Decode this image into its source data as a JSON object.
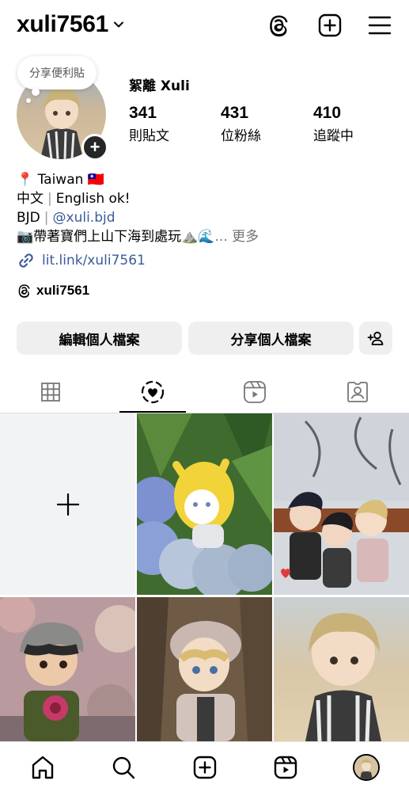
{
  "header": {
    "username": "xuli7561"
  },
  "profile": {
    "note": "分享便利貼",
    "display_name": "絮離 Xuli",
    "stats": [
      {
        "value": "341",
        "label": "則貼文"
      },
      {
        "value": "431",
        "label": "位粉絲"
      },
      {
        "value": "410",
        "label": "追蹤中"
      }
    ]
  },
  "bio": {
    "line1_pin": "📍",
    "line1_text": "Taiwan",
    "line1_flag": "🇹🇼",
    "line2_a": "中文",
    "line2_sep": "|",
    "line2_b": "English ok!",
    "line3_a": "BJD",
    "line3_sep": "|",
    "line3_mention": "@xuli.bjd",
    "line4_text": "📷帶著寶們上山下海到處玩⛰️🌊",
    "line4_ellipsis": "...",
    "line4_more": "更多",
    "link": "lit.link/xuli7561",
    "threads_handle": "xuli7561"
  },
  "buttons": {
    "edit": "編輯個人檔案",
    "share": "分享個人檔案"
  },
  "tabs": [
    {
      "name": "grid",
      "icon": "grid-icon"
    },
    {
      "name": "highlights",
      "icon": "heart-dashed-circle-icon",
      "active": true
    },
    {
      "name": "reels",
      "icon": "reels-icon"
    },
    {
      "name": "tagged",
      "icon": "tagged-person-icon"
    }
  ],
  "colors": {
    "link": "#3b5b9a",
    "button_bg": "#efefef",
    "new_post_bg": "#f1f3f4"
  }
}
